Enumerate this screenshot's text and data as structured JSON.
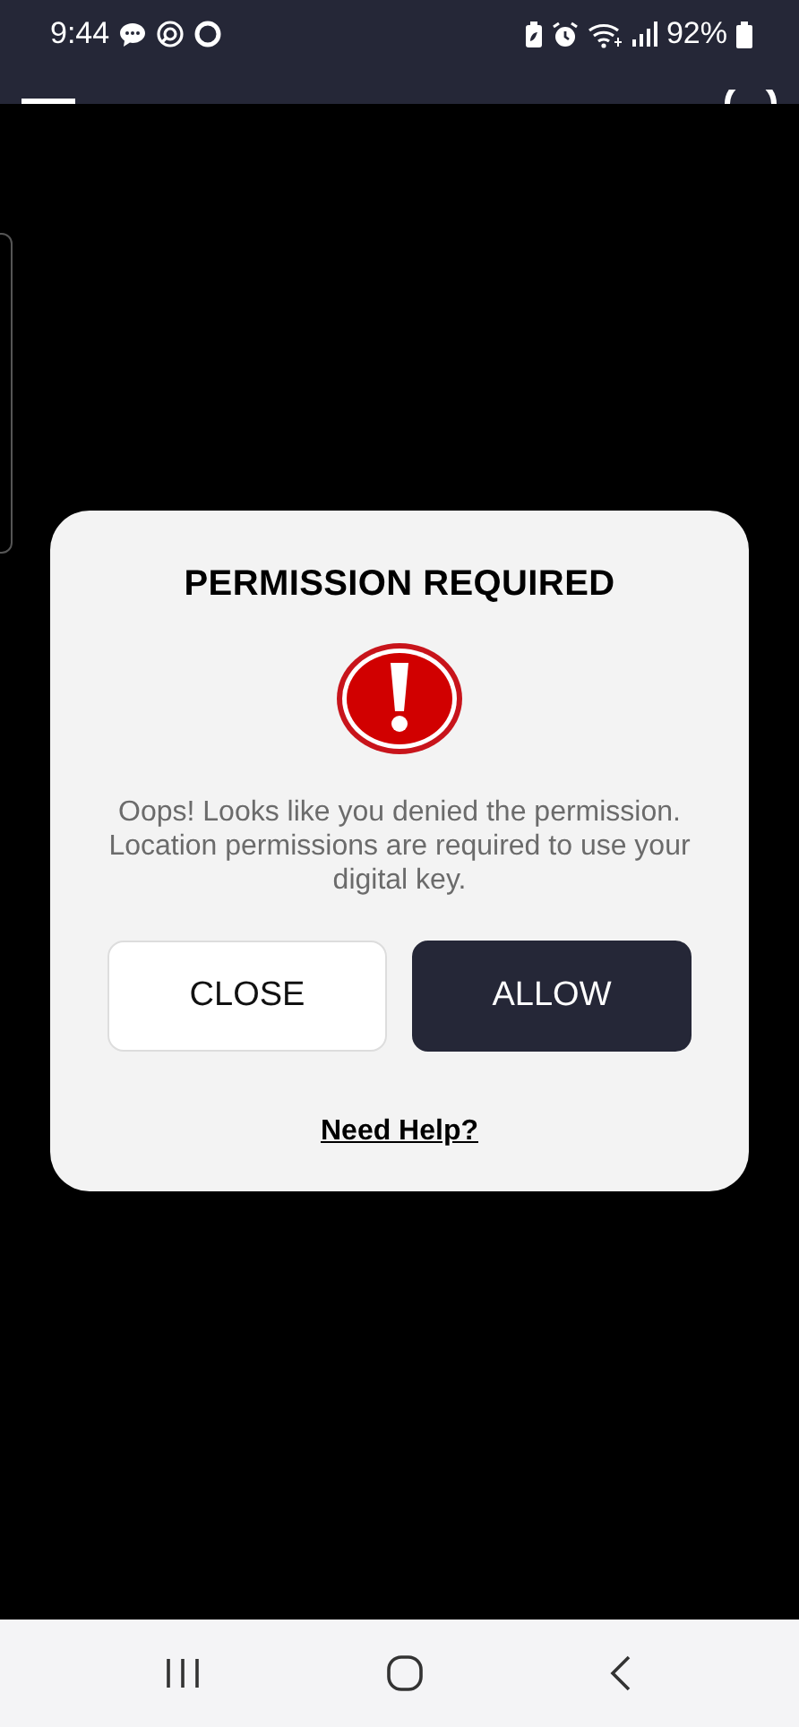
{
  "status_bar": {
    "time": "9:44",
    "battery": "92%"
  },
  "dialog": {
    "title": "PERMISSION REQUIRED",
    "message": "Oops! Looks like you denied the permission. Location permissions are required to use your digital key.",
    "buttons": [
      {
        "label": "CLOSE",
        "kind": "secondary"
      },
      {
        "label": "ALLOW",
        "kind": "primary"
      }
    ],
    "help_link": "Need Help?"
  }
}
